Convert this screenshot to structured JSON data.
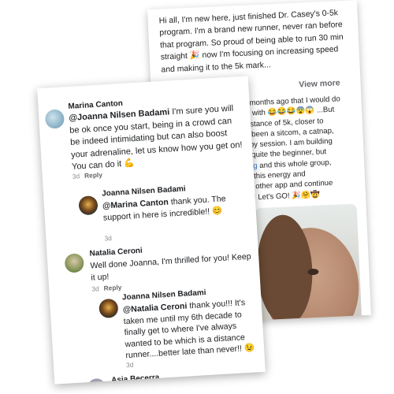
{
  "post": {
    "text": "Hi all, I'm new here, just finished Dr. Casey's 0-5k program. I'm a brand new runner, never ran before that program. So proud of being able to run 30 min straight 🎉 now I'm focusing on increasing speed and making it to the 5k mark...",
    "view_more": "View more",
    "continued_lines": [
      "d me 3 months ago that I would do",
      "bonded with 😂😂😂😨😱 ...But",
      "e the distance of 5k, closer to",
      "ould've been a sitcom, a catnap,",
      "a therapy session. I am building",
      "I'm still quite the beginner, but",
      "coaching and this whole group,",
      "'s bring this energy and",
      "ching 's other app and continue",
      "gement! Let's GO! 🎉🤗🤠"
    ]
  },
  "comments": {
    "marina": {
      "name": "Marina Canton",
      "mention": "@Joanna Nilsen Badami",
      "text": " I'm sure you will be ok once you start, being in a crowd can be indeed intimidating but can also boost your adrenaline, let us know how you get on! You can do it 💪",
      "time": "3d",
      "reply": "Reply"
    },
    "joanna_1": {
      "name": "Joanna Nilsen Badami",
      "mention": "@Marina Canton",
      "text": " thank you. The support in here is incredible!! 😊",
      "time": "3d"
    },
    "natalia": {
      "name": "Natalia Ceroni",
      "text": "Well done Joanna, I'm thrilled for you! Keep it up!",
      "time": "3d",
      "reply": "Reply"
    },
    "joanna_2": {
      "name": "Joanna Nilsen Badami",
      "mention": "@Natalia Ceroni",
      "text": " thank you!!! It's taken me until my 6th decade to finally get to where I've always wanted to be which is a distance runner....better late than never!! 😉",
      "time": "3d"
    },
    "asia": {
      "name": "Asia Becerra"
    }
  }
}
